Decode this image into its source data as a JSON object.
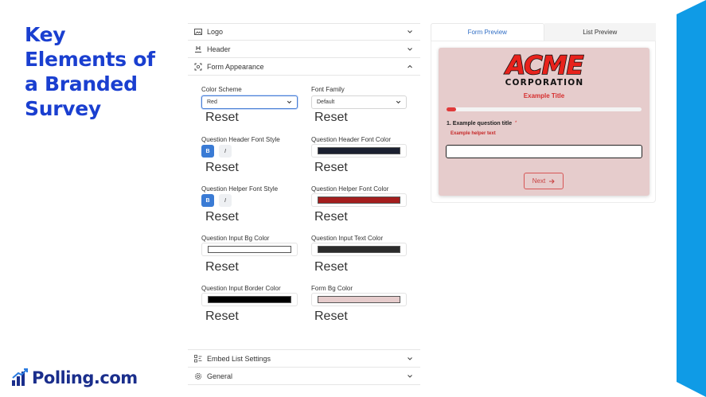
{
  "slide": {
    "title_lines": [
      "Key",
      "Elements of",
      "a Branded",
      "Survey"
    ],
    "brand_name": "Polling.com",
    "brand_color": "#1a3fd0"
  },
  "settings": {
    "sections_top": [
      {
        "label": "Logo",
        "icon": "image-icon"
      },
      {
        "label": "Header",
        "icon": "header-icon"
      },
      {
        "label": "Form Appearance",
        "icon": "palette-icon"
      }
    ],
    "sections_bottom": [
      {
        "label": "Embed List Settings",
        "icon": "list-settings-icon"
      },
      {
        "label": "General",
        "icon": "gear-icon"
      }
    ],
    "reset_label": "Reset",
    "fields": {
      "color_scheme": {
        "label": "Color Scheme",
        "value": "Red"
      },
      "font_family": {
        "label": "Font Family",
        "value": "Default"
      },
      "q_header_style": {
        "label": "Question Header Font Style",
        "bold": "B",
        "italic": "I"
      },
      "q_header_color": {
        "label": "Question Header Font Color",
        "color": "#1b2030"
      },
      "q_helper_style": {
        "label": "Question Helper Font Style",
        "bold": "B",
        "italic": "I"
      },
      "q_helper_color": {
        "label": "Question Helper Font Color",
        "color": "#a41e1e"
      },
      "q_input_bg": {
        "label": "Question Input Bg Color",
        "color": "#ffffff"
      },
      "q_input_text": {
        "label": "Question Input Text Color",
        "color": "#2b2b2b"
      },
      "q_input_border": {
        "label": "Question Input Border Color",
        "color": "#000000"
      },
      "form_bg": {
        "label": "Form Bg Color",
        "color": "#e6cccc"
      }
    }
  },
  "preview": {
    "tabs": [
      "Form Preview",
      "List Preview"
    ],
    "logo_word": "ACME",
    "logo_sub": "CORPORATION",
    "example_title": "Example Title",
    "question_number": "1.",
    "question_title": "Example question title",
    "required_mark": "*",
    "helper_text": "Example helper text",
    "next_label": "Next",
    "progress_fraction": 0.05,
    "accent_color": "#e03a3a",
    "form_bg": "#e6cccc"
  }
}
